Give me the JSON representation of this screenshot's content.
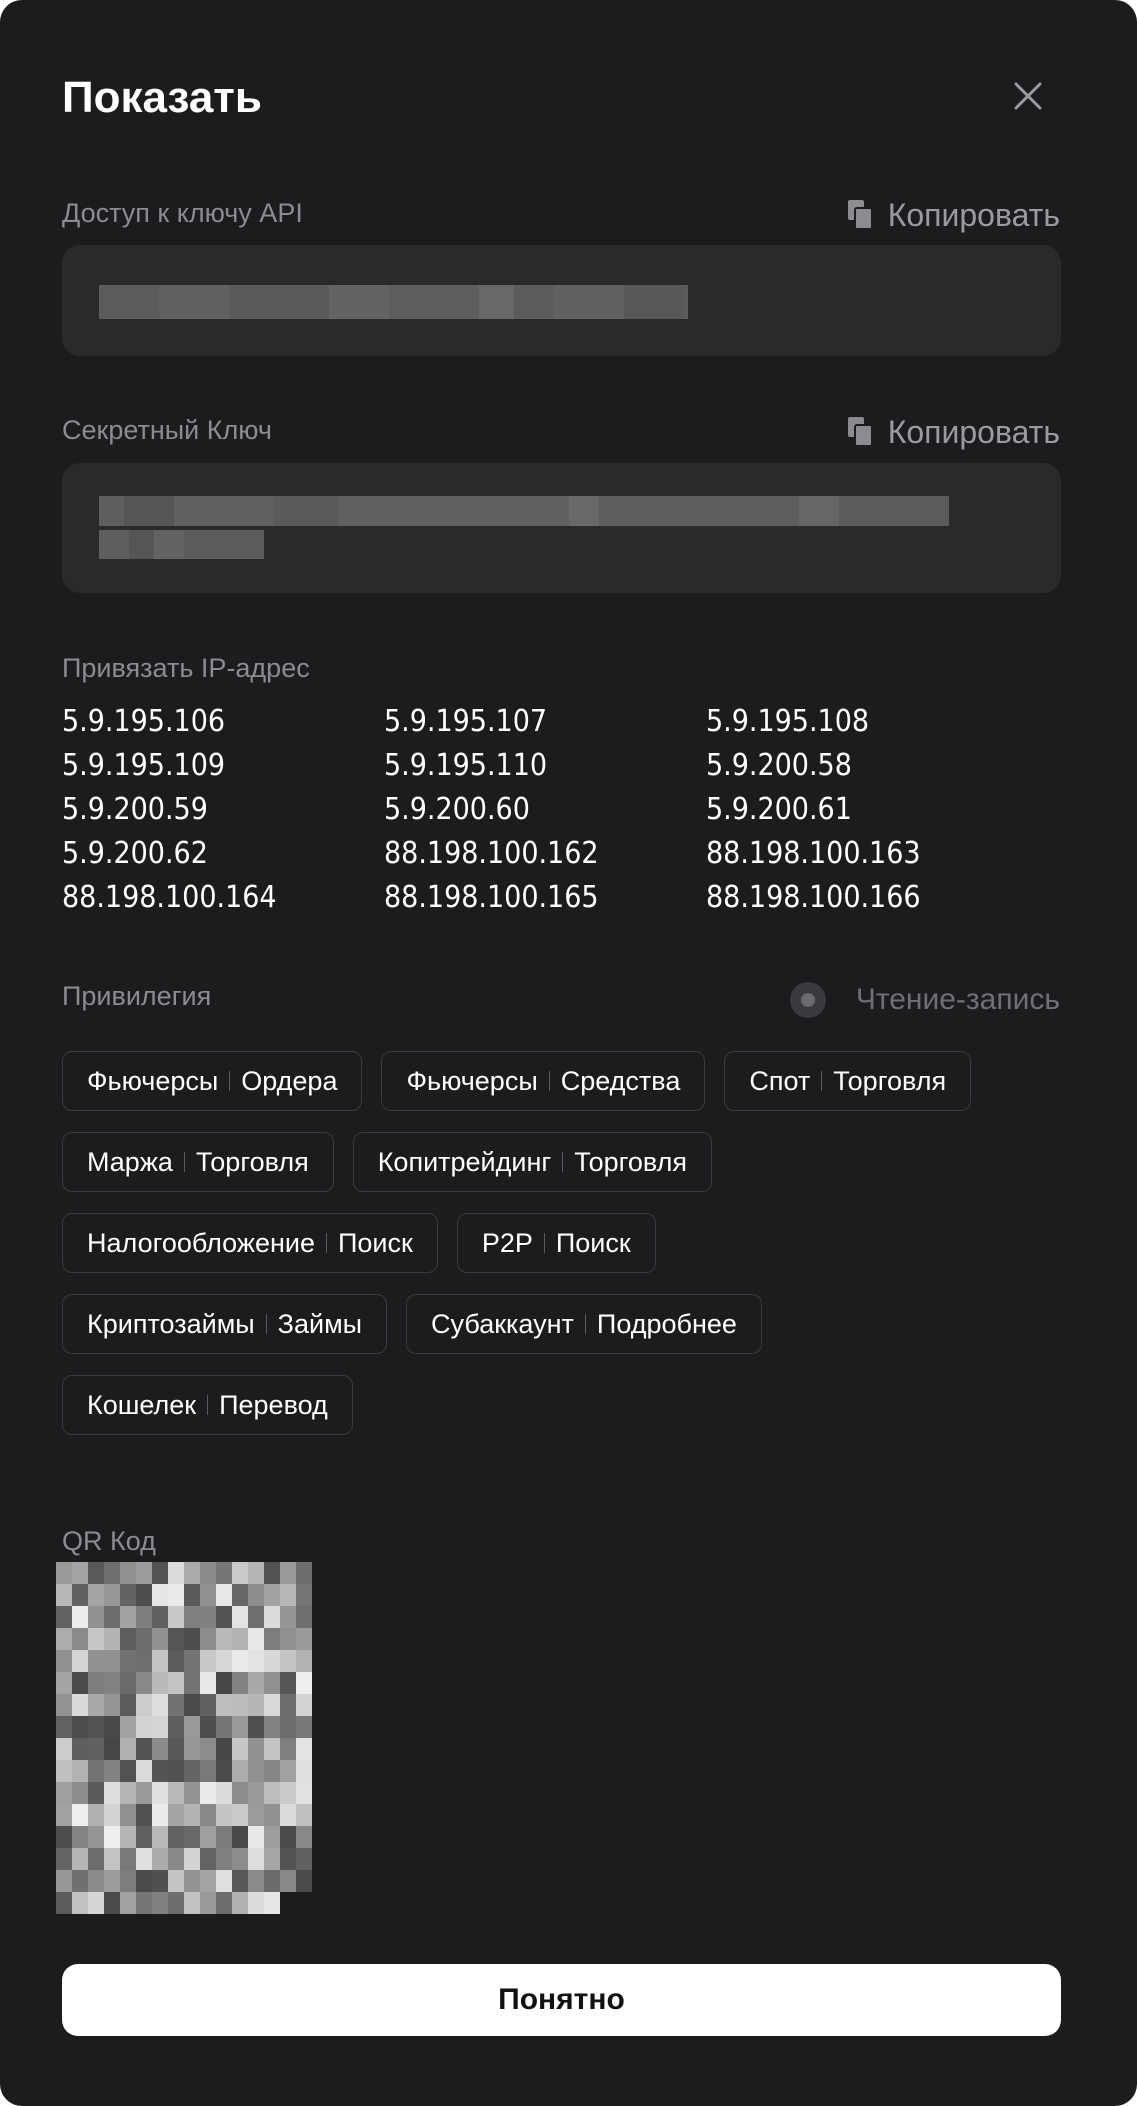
{
  "modal": {
    "title": "Показать",
    "close_icon": "close-icon"
  },
  "api_key": {
    "label": "Доступ к ключу API",
    "copy_label": "Копировать",
    "copy_icon": "copy-icon"
  },
  "secret_key": {
    "label": "Секретный Ключ",
    "copy_label": "Копировать",
    "copy_icon": "copy-icon"
  },
  "ip_binding": {
    "label": "Привязать IP-адрес",
    "addresses": [
      "5.9.195.106",
      "5.9.195.107",
      "5.9.195.108",
      "5.9.195.109",
      "5.9.195.110",
      "5.9.200.58",
      "5.9.200.59",
      "5.9.200.60",
      "5.9.200.61",
      "5.9.200.62",
      "88.198.100.162",
      "88.198.100.163",
      "88.198.100.164",
      "88.198.100.165",
      "88.198.100.166"
    ]
  },
  "privileges": {
    "label": "Привилегия",
    "mode_label": "Чтение-запись",
    "rows": [
      [
        {
          "name": "Фьючерсы",
          "perm": "Ордера"
        },
        {
          "name": "Фьючерсы",
          "perm": "Средства"
        },
        {
          "name": "Спот",
          "perm": "Торговля"
        }
      ],
      [
        {
          "name": "Маржа",
          "perm": "Торговля"
        },
        {
          "name": "Копитрейдинг",
          "perm": "Торговля"
        }
      ],
      [
        {
          "name": "Налогообложение",
          "perm": "Поиск"
        },
        {
          "name": "P2P",
          "perm": "Поиск"
        }
      ],
      [
        {
          "name": "Криптозаймы",
          "perm": "Займы"
        },
        {
          "name": "Субаккаунт",
          "perm": "Подробнее"
        }
      ],
      [
        {
          "name": "Кошелек",
          "perm": "Перевод"
        }
      ]
    ]
  },
  "qr": {
    "label": "QR Код"
  },
  "confirm_button": {
    "label": "Понятно"
  },
  "colors": {
    "background": "#1c1c1e",
    "field_background": "#2a2a2d",
    "label_gray": "#8b8b90",
    "button_white": "#ffffff"
  }
}
